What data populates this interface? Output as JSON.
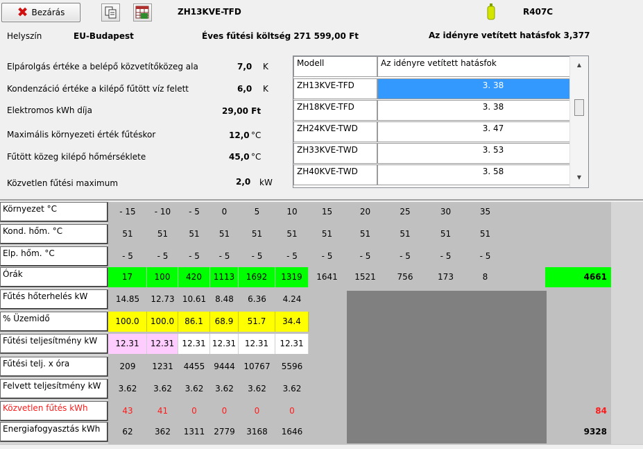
{
  "toolbar": {
    "close_label": "Bezárás",
    "model": "ZH13KVE-TFD",
    "refrigerant": "R407C"
  },
  "info": {
    "location_label": "Helyszín",
    "location_value": "EU-Budapest",
    "cost_label": "Éves fűtési költség 271 599,00 Ft",
    "efficiency_label": "Az idényre vetített hatásfok 3,377"
  },
  "params": [
    {
      "label": "Elpárolgás értéke a belépő közvetítőközeg ala",
      "value": "7,0",
      "unit": "K"
    },
    {
      "label": "Kondenzáció értéke a kilépő fűtött víz felett",
      "value": "6,0",
      "unit": "K"
    },
    {
      "label": "Elektromos kWh díja",
      "value": "29,00 Ft",
      "unit": ""
    },
    {
      "label": "Maximális környezeti érték fűtéskor",
      "value": "12,0",
      "unit": "°C"
    },
    {
      "label": "Fűtött közeg kilépő hőmérséklete",
      "value": "45,0",
      "unit": "°C"
    },
    {
      "label": "Közvetlen fűtési maximum",
      "value": "2,0",
      "unit": "kW"
    }
  ],
  "model_list": {
    "headers": [
      "Modell",
      "Az idényre vetített hatásfok"
    ],
    "rows": [
      {
        "model": "ZH13KVE-TFD",
        "value": "3. 38",
        "selected": true
      },
      {
        "model": "ZH18KVE-TFD",
        "value": "3. 38",
        "selected": false
      },
      {
        "model": "ZH24KVE-TWD",
        "value": "3. 47",
        "selected": false
      },
      {
        "model": "ZH33KVE-TWD",
        "value": "3. 53",
        "selected": false
      },
      {
        "model": "ZH40KVE-TWD",
        "value": "3. 58",
        "selected": false
      }
    ]
  },
  "grid": {
    "rows": [
      {
        "label": "Környezet °C",
        "cells": [
          "- 15",
          "- 10",
          "- 5",
          "0",
          "5",
          "10",
          "15",
          "20",
          "25",
          "30",
          "35"
        ],
        "total": ""
      },
      {
        "label": "Kond. hőm. °C",
        "cells": [
          "51",
          "51",
          "51",
          "51",
          "51",
          "51",
          "51",
          "51",
          "51",
          "51",
          "51"
        ],
        "total": ""
      },
      {
        "label": "Elp. hőm. °C",
        "cells": [
          "- 5",
          "- 5",
          "- 5",
          "- 5",
          "- 5",
          "- 5",
          "- 5",
          "- 5",
          "- 5",
          "- 5",
          "- 5"
        ],
        "total": ""
      },
      {
        "label": "Órák",
        "cells": [
          "17",
          "100",
          "420",
          "1113",
          "1692",
          "1319",
          "1641",
          "1521",
          "756",
          "173",
          "8"
        ],
        "total": "4661"
      },
      {
        "label": "Fűtés hőterhelés kW",
        "cells": [
          "14.85",
          "12.73",
          "10.61",
          "8.48",
          "6.36",
          "4.24"
        ],
        "total": ""
      },
      {
        "label": "% Üzemidő",
        "cells": [
          "100.0",
          "100.0",
          "86.1",
          "68.9",
          "51.7",
          "34.4"
        ],
        "total": ""
      },
      {
        "label": "Fűtési teljesítmény kW",
        "cells": [
          "12.31",
          "12.31",
          "12.31",
          "12.31",
          "12.31",
          "12.31"
        ],
        "total": ""
      },
      {
        "label": "Fűtési telj. x óra",
        "cells": [
          "209",
          "1231",
          "4455",
          "9444",
          "10767",
          "5596"
        ],
        "total": ""
      },
      {
        "label": "Felvett teljesítmény kW",
        "cells": [
          "3.62",
          "3.62",
          "3.62",
          "3.62",
          "3.62",
          "3.62"
        ],
        "total": ""
      },
      {
        "label": "Közvetlen fűtés kWh",
        "cells": [
          "43",
          "41",
          "0",
          "0",
          "0",
          "0"
        ],
        "total": "84"
      },
      {
        "label": "Energiafogyasztás kWh",
        "cells": [
          "62",
          "362",
          "1311",
          "2779",
          "3168",
          "1646"
        ],
        "total": "9328"
      }
    ]
  },
  "colors": {
    "green": "#00ff00",
    "yellow": "#ffff00",
    "pink": "#ffccff",
    "red_text": "#ff1a1a",
    "selection": "#3399ff"
  }
}
